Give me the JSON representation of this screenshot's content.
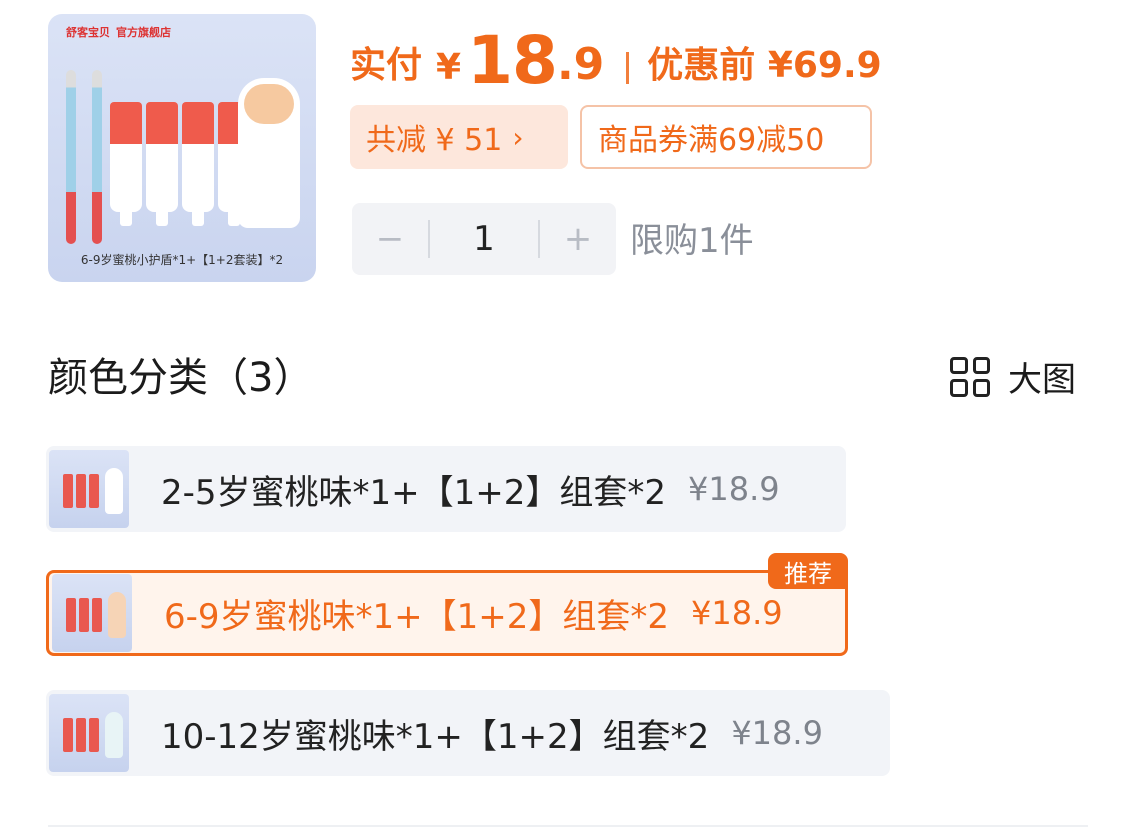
{
  "product": {
    "store_brand": "舒客宝贝",
    "store_tag": "官方旗舰店",
    "thumbnail_caption": "6-9岁蜜桃小护盾*1+【1+2套装】*2"
  },
  "price": {
    "pay_label": "实付",
    "currency": "¥",
    "amount_int": "18",
    "amount_dec": ".9",
    "before_label": "优惠前 ¥69.9"
  },
  "discounts": {
    "total_label": "共减 ¥ 51",
    "total_arrow": "›",
    "coupon_label": "商品券满69减50"
  },
  "quantity": {
    "minus": "−",
    "value": "1",
    "plus": "+",
    "limit_text": "限购1件"
  },
  "variations": {
    "title": "颜色分类（3）",
    "big_view_label": "大图",
    "recommend_badge": "推荐",
    "options": [
      {
        "name": "2-5岁蜜桃味*1+【1+2】组套*2",
        "price": "¥18.9"
      },
      {
        "name": "6-9岁蜜桃味*1+【1+2】组套*2",
        "price": "¥18.9"
      },
      {
        "name": "10-12岁蜜桃味*1+【1+2】组套*2",
        "price": "¥18.9"
      }
    ]
  },
  "colors": {
    "accent": "#f0691a",
    "chip_bg": "#fde7dc",
    "option_bg": "#f2f4f8",
    "selected_bg": "#fff4ec",
    "muted_text": "#8a8f99"
  }
}
